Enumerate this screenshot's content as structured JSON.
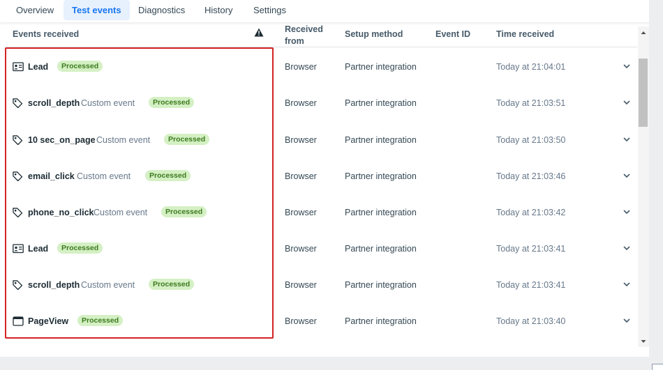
{
  "tabs": [
    {
      "label": "Overview"
    },
    {
      "label": "Test events"
    },
    {
      "label": "Diagnostics"
    },
    {
      "label": "History"
    },
    {
      "label": "Settings"
    }
  ],
  "columns": {
    "events_received": "Events received",
    "received_from": "Received from",
    "setup_method": "Setup method",
    "event_id": "Event ID",
    "time_received": "Time received"
  },
  "rows": [
    {
      "icon": "id-card-icon",
      "name": "Lead",
      "sub": "",
      "status": "Processed",
      "from": "Browser",
      "method": "Partner integration",
      "event_id": "",
      "time": "Today at 21:04:01"
    },
    {
      "icon": "tag-icon",
      "name": "scroll_depth",
      "sub": "Custom event",
      "status": "Processed",
      "from": "Browser",
      "method": "Partner integration",
      "event_id": "",
      "time": "Today at 21:03:51"
    },
    {
      "icon": "tag-icon",
      "name": "10 sec_on_page",
      "sub": "Custom event",
      "status": "Processed",
      "from": "Browser",
      "method": "Partner integration",
      "event_id": "",
      "time": "Today at 21:03:50"
    },
    {
      "icon": "tag-icon",
      "name": "email_click",
      "sub": "Custom event",
      "status": "Processed",
      "from": "Browser",
      "method": "Partner integration",
      "event_id": "",
      "time": "Today at 21:03:46"
    },
    {
      "icon": "tag-icon",
      "name": "phone_no_click",
      "sub": "Custom event",
      "status": "Processed",
      "from": "Browser",
      "method": "Partner integration",
      "event_id": "",
      "time": "Today at 21:03:42"
    },
    {
      "icon": "id-card-icon",
      "name": "Lead",
      "sub": "",
      "status": "Processed",
      "from": "Browser",
      "method": "Partner integration",
      "event_id": "",
      "time": "Today at 21:03:41"
    },
    {
      "icon": "tag-icon",
      "name": "scroll_depth",
      "sub": "Custom event",
      "status": "Processed",
      "from": "Browser",
      "method": "Partner integration",
      "event_id": "",
      "time": "Today at 21:03:41"
    },
    {
      "icon": "browser-window-icon",
      "name": "PageView",
      "sub": "",
      "status": "Processed",
      "from": "Browser",
      "method": "Partner integration",
      "event_id": "",
      "time": "Today at 21:03:40"
    }
  ],
  "colors": {
    "accent": "#1877f2",
    "badge_bg": "#d4f0c4",
    "badge_text": "#3d7a1f",
    "highlight": "#d32323"
  }
}
